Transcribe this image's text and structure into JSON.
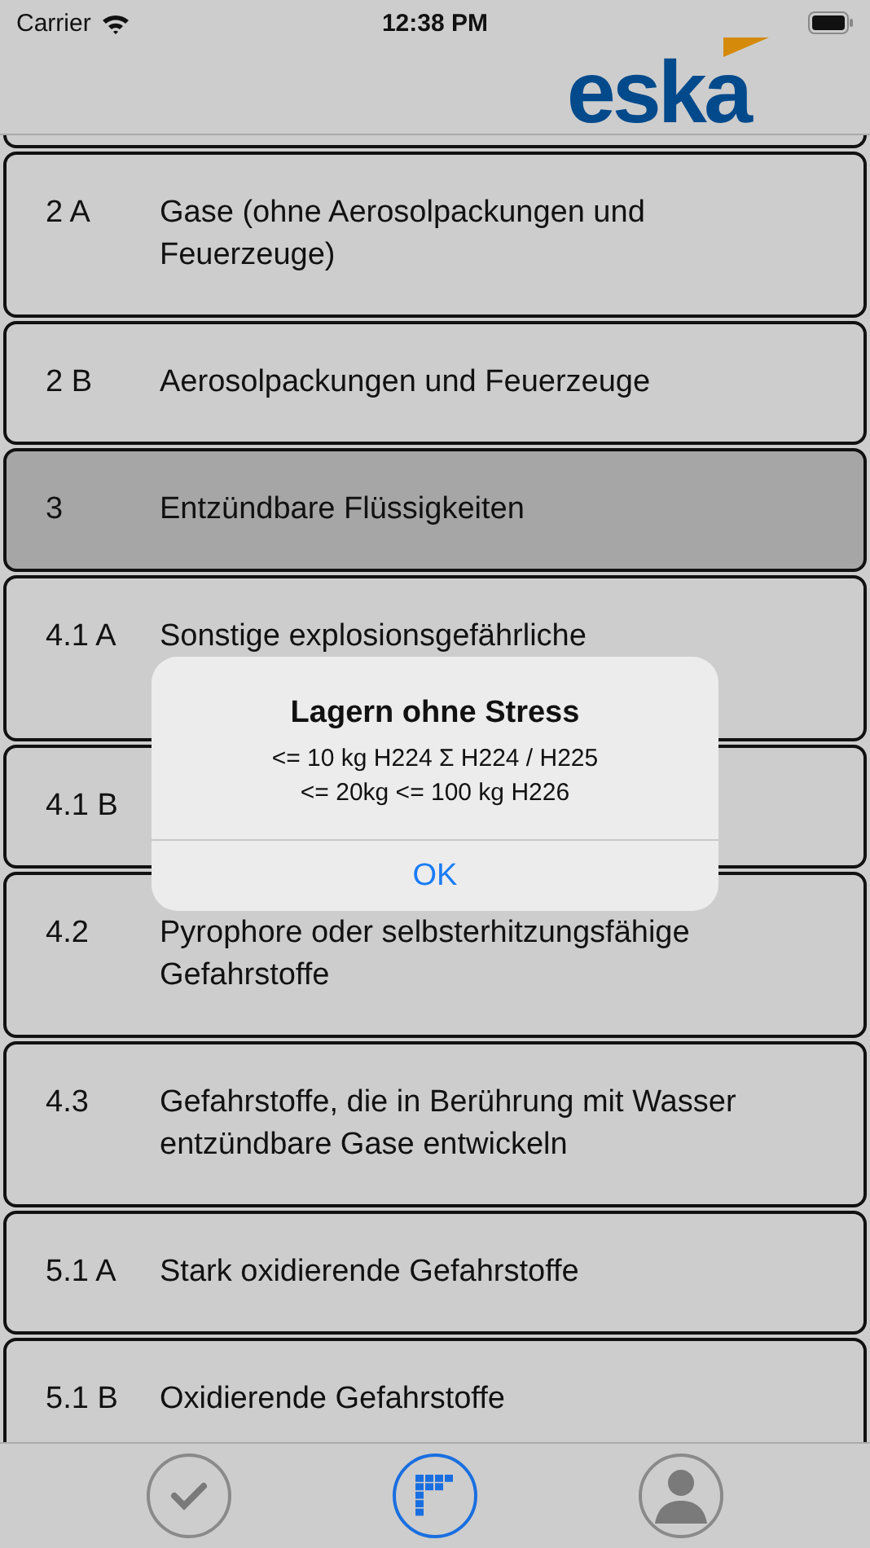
{
  "status_bar": {
    "carrier": "Carrier",
    "time": "12:38 PM"
  },
  "header": {
    "logo": "eska"
  },
  "list": [
    {
      "code": "2 A",
      "text": "Gase (ohne Aerosolpackungen und Feuerzeuge)",
      "selected": false
    },
    {
      "code": "2 B",
      "text": "Aerosolpackungen und Feuerzeuge",
      "selected": false
    },
    {
      "code": "3",
      "text": "Entzündbare Flüssigkeiten",
      "selected": true
    },
    {
      "code": "4.1 A",
      "text": "Sonstige explosionsgefährliche",
      "selected": false,
      "kind": "tall"
    },
    {
      "code": "4.1 B",
      "selected": false
    },
    {
      "code": "4.2",
      "text": "Pyrophore oder selbsterhitzungsfähige Gefahrstoffe",
      "selected": false
    },
    {
      "code": "4.3",
      "text": "Gefahrstoffe, die in Berührung mit Wasser entzündbare Gase entwickeln",
      "selected": false
    },
    {
      "code": "5.1 A",
      "text": "Stark oxidierende Gefahrstoffe",
      "selected": false
    },
    {
      "code": "5.1 B",
      "text": "Oxidierende Gefahrstoffe",
      "selected": false
    }
  ],
  "alert": {
    "title": "Lagern ohne Stress",
    "message": "<= 10 kg H224 Σ H224 / H225 <= 20kg <= 100 kg H226",
    "button": "OK"
  },
  "tabs": [
    {
      "kind": "check",
      "selected": false
    },
    {
      "kind": "grid",
      "selected": true
    },
    {
      "kind": "person",
      "selected": false
    }
  ]
}
